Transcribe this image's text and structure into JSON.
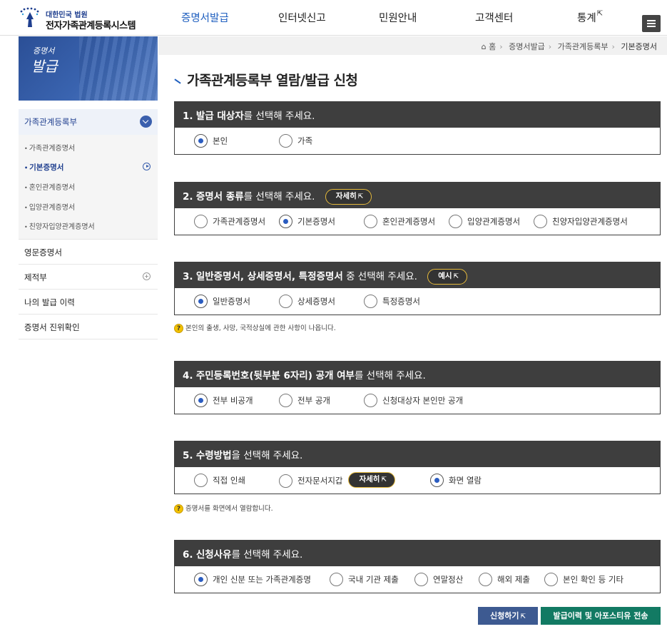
{
  "header": {
    "logo_sub": "대한민국 법원",
    "logo_main": "전자가족관계등록시스템",
    "nav": [
      {
        "label": "증명서발급",
        "active": true,
        "external": false
      },
      {
        "label": "인터넷신고",
        "active": false,
        "external": false
      },
      {
        "label": "민원안내",
        "active": false,
        "external": false
      },
      {
        "label": "고객센터",
        "active": false,
        "external": false
      },
      {
        "label": "통계",
        "active": false,
        "external": true
      }
    ],
    "menu_icon": "hamburger-icon",
    "external_icon": "⇱"
  },
  "breadcrumb": [
    "홈",
    "증명서발급",
    "가족관계등록부",
    "기본증명서"
  ],
  "sidebar": {
    "banner_line1": "증명서",
    "banner_line2": "발급",
    "categories": [
      {
        "label": "가족관계등록부",
        "open": true
      },
      {
        "label": "영문증명서"
      },
      {
        "label": "제적부"
      },
      {
        "label": "나의 발급 이력"
      },
      {
        "label": "증명서 진위확인"
      }
    ],
    "sub_items": [
      {
        "label": "가족관계증명서",
        "current": false
      },
      {
        "label": "기본증명서",
        "current": true
      },
      {
        "label": "혼인관계증명서",
        "current": false
      },
      {
        "label": "입양관계증명서",
        "current": false
      },
      {
        "label": "친양자입양관계증명서",
        "current": false
      }
    ]
  },
  "main": {
    "title": "가족관계등록부 열람/발급 신청",
    "sections": [
      {
        "num": "1.",
        "bold": "발급 대상자",
        "rest": "를 선택해 주세요.",
        "options": [
          "본인",
          "가족"
        ],
        "selected": 0
      },
      {
        "num": "2.",
        "bold": "증명서 종류",
        "rest": "를 선택해 주세요.",
        "pill": "자세히",
        "options": [
          "가족관계증명서",
          "기본증명서",
          "혼인관계증명서",
          "입양관계증명서",
          "친양자입양관계증명서"
        ],
        "selected": 1
      },
      {
        "num": "3.",
        "bold": "일반증명서, 상세증명서, 특정증명서",
        "rest": " 중 선택해 주세요.",
        "pill": "예시",
        "options": [
          "일반증명서",
          "상세증명서",
          "특정증명서"
        ],
        "selected": 0,
        "note": "본인의 출생, 사망, 국적상실에 관한 사항이 나옵니다."
      },
      {
        "num": "4.",
        "bold": "주민등록번호(뒷부분 6자리) 공개 여부",
        "rest": "를 선택해 주세요.",
        "options": [
          "전부 비공개",
          "전부 공개",
          "신청대상자 본인만 공개"
        ],
        "selected": 0
      },
      {
        "num": "5.",
        "bold": "수령방법",
        "rest": "을 선택해 주세요.",
        "options": [
          "직접 인쇄",
          "전자문서지갑",
          "화면 열람"
        ],
        "selected": 2,
        "option_pill": "자세히",
        "note": "증명서를 화면에서 열람합니다."
      },
      {
        "num": "6.",
        "bold": "신청사유",
        "rest": "를 선택해 주세요.",
        "options": [
          "개인 신분 또는 가족관계증명",
          "국내 기관 제출",
          "연말정산",
          "해외 제출",
          "본인 확인 등 기타"
        ],
        "selected": 0
      }
    ],
    "help_mark": "?",
    "buttons": {
      "apply": "신청하기",
      "history": "발급이력 및 아포스티유 전송"
    }
  },
  "colors": {
    "accent": "#1f5fbf",
    "section_header": "#3e3e3e",
    "pill_border": "#e4b93c",
    "apply_button": "#3d5a91",
    "history_button": "#127a63"
  }
}
